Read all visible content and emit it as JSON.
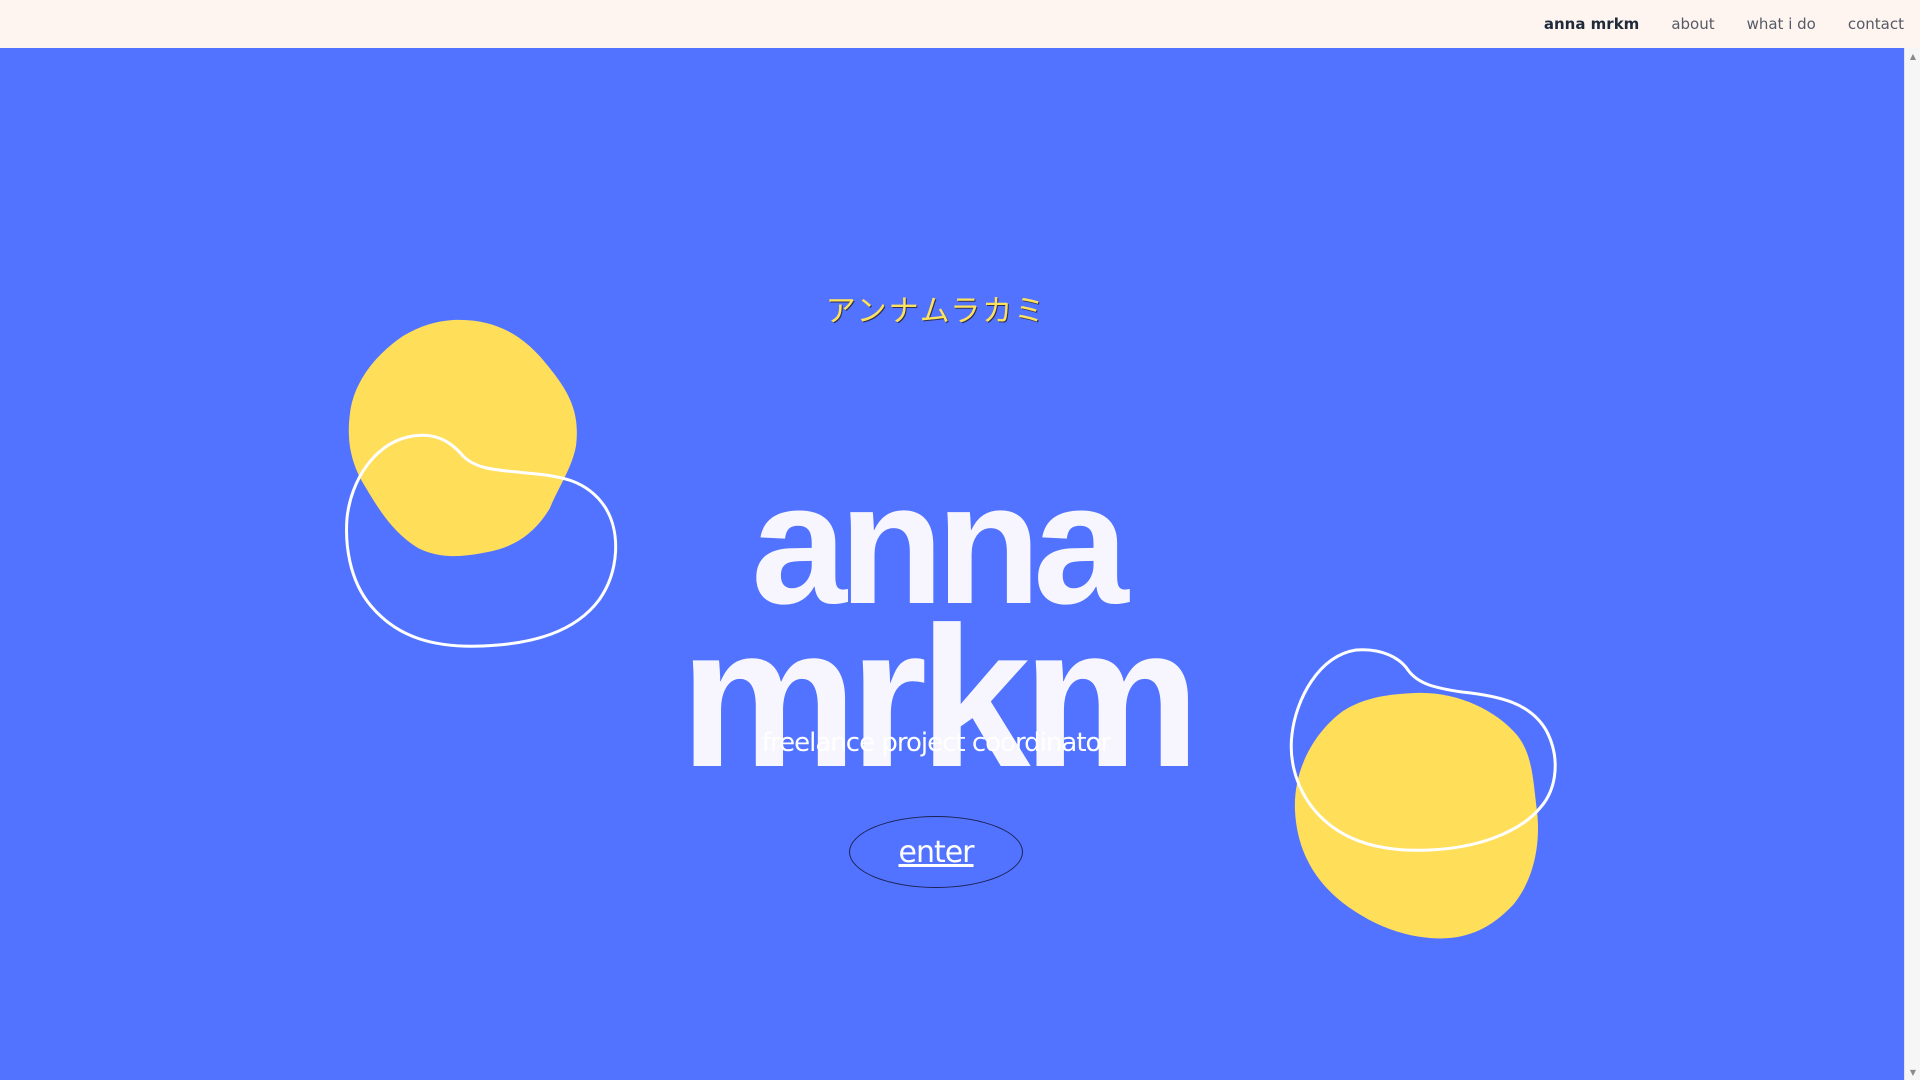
{
  "nav": {
    "brand": "anna mrkm",
    "items": [
      {
        "label": "about"
      },
      {
        "label": "what i do"
      },
      {
        "label": "contact"
      }
    ]
  },
  "hero": {
    "kana": "アンナムラカミ",
    "name_line1": "anna",
    "name_line2": "mrkm",
    "subtitle": "freelance project coordinator",
    "enter_label": "enter"
  },
  "colors": {
    "topbar_bg": "#fff5f0",
    "hero_bg": "#5273ff",
    "accent_yellow": "#ffde5a",
    "text_light": "#f7f6ff",
    "outline": "#ffffff"
  }
}
